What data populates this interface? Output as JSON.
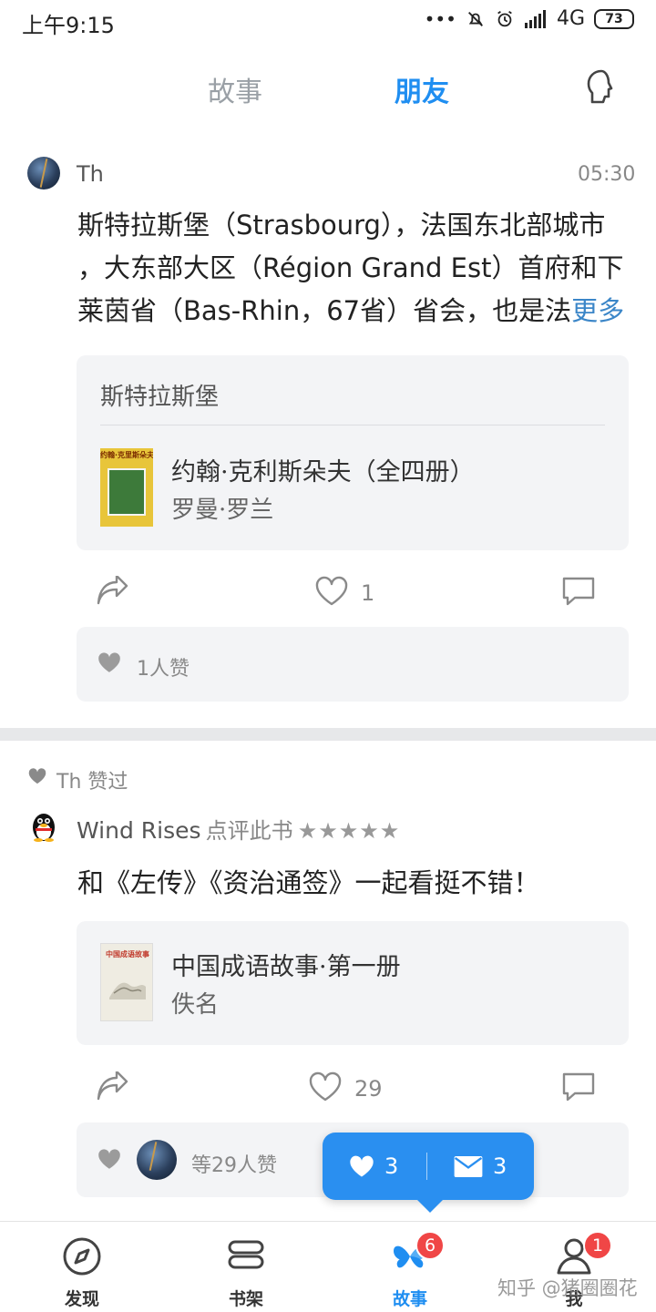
{
  "status_bar": {
    "time": "上午9:15",
    "network": "4G",
    "battery": "73",
    "dots": "•••"
  },
  "top_tabs": {
    "story": "故事",
    "friends": "朋友"
  },
  "post1": {
    "user": "Th",
    "time": "05:30",
    "text_line1": "斯特拉斯堡（Strasbourg），法国东北部城市",
    "text_line2": "，大东部大区（Région Grand Est）首府和下",
    "text_line3": "莱茵省（Bas-Rhin，67省）省会，也是法",
    "more": "更多",
    "ref_title": "斯特拉斯堡",
    "book_title": "约翰·克利斯朵夫（全四册）",
    "book_author": "罗曼·罗兰",
    "cover_text": "约翰·克里斯朵夫",
    "like_count": "1",
    "likes_summary": "1人赞"
  },
  "post2": {
    "liked_by": "Th 赞过",
    "reviewer": "Wind Rises",
    "action": "点评此书",
    "stars": "★★★★★",
    "text": "和《左传》《资治通签》一起看挺不错！",
    "book_title": "中国成语故事·第一册",
    "book_author": "佚名",
    "cover_text": "中国成语故事",
    "like_count": "29",
    "likes_summary": "等29人赞"
  },
  "bubble": {
    "likes": "3",
    "messages": "3"
  },
  "bottom_nav": {
    "discover": "发现",
    "bookshelf": "书架",
    "stories": "故事",
    "me": "我",
    "stories_badge": "6",
    "me_badge": "1"
  },
  "watermark": "知乎 @猪圈圈花",
  "colors": {
    "accent": "#1f8ef1",
    "badge": "#f04646",
    "card_bg": "#f3f4f6"
  }
}
